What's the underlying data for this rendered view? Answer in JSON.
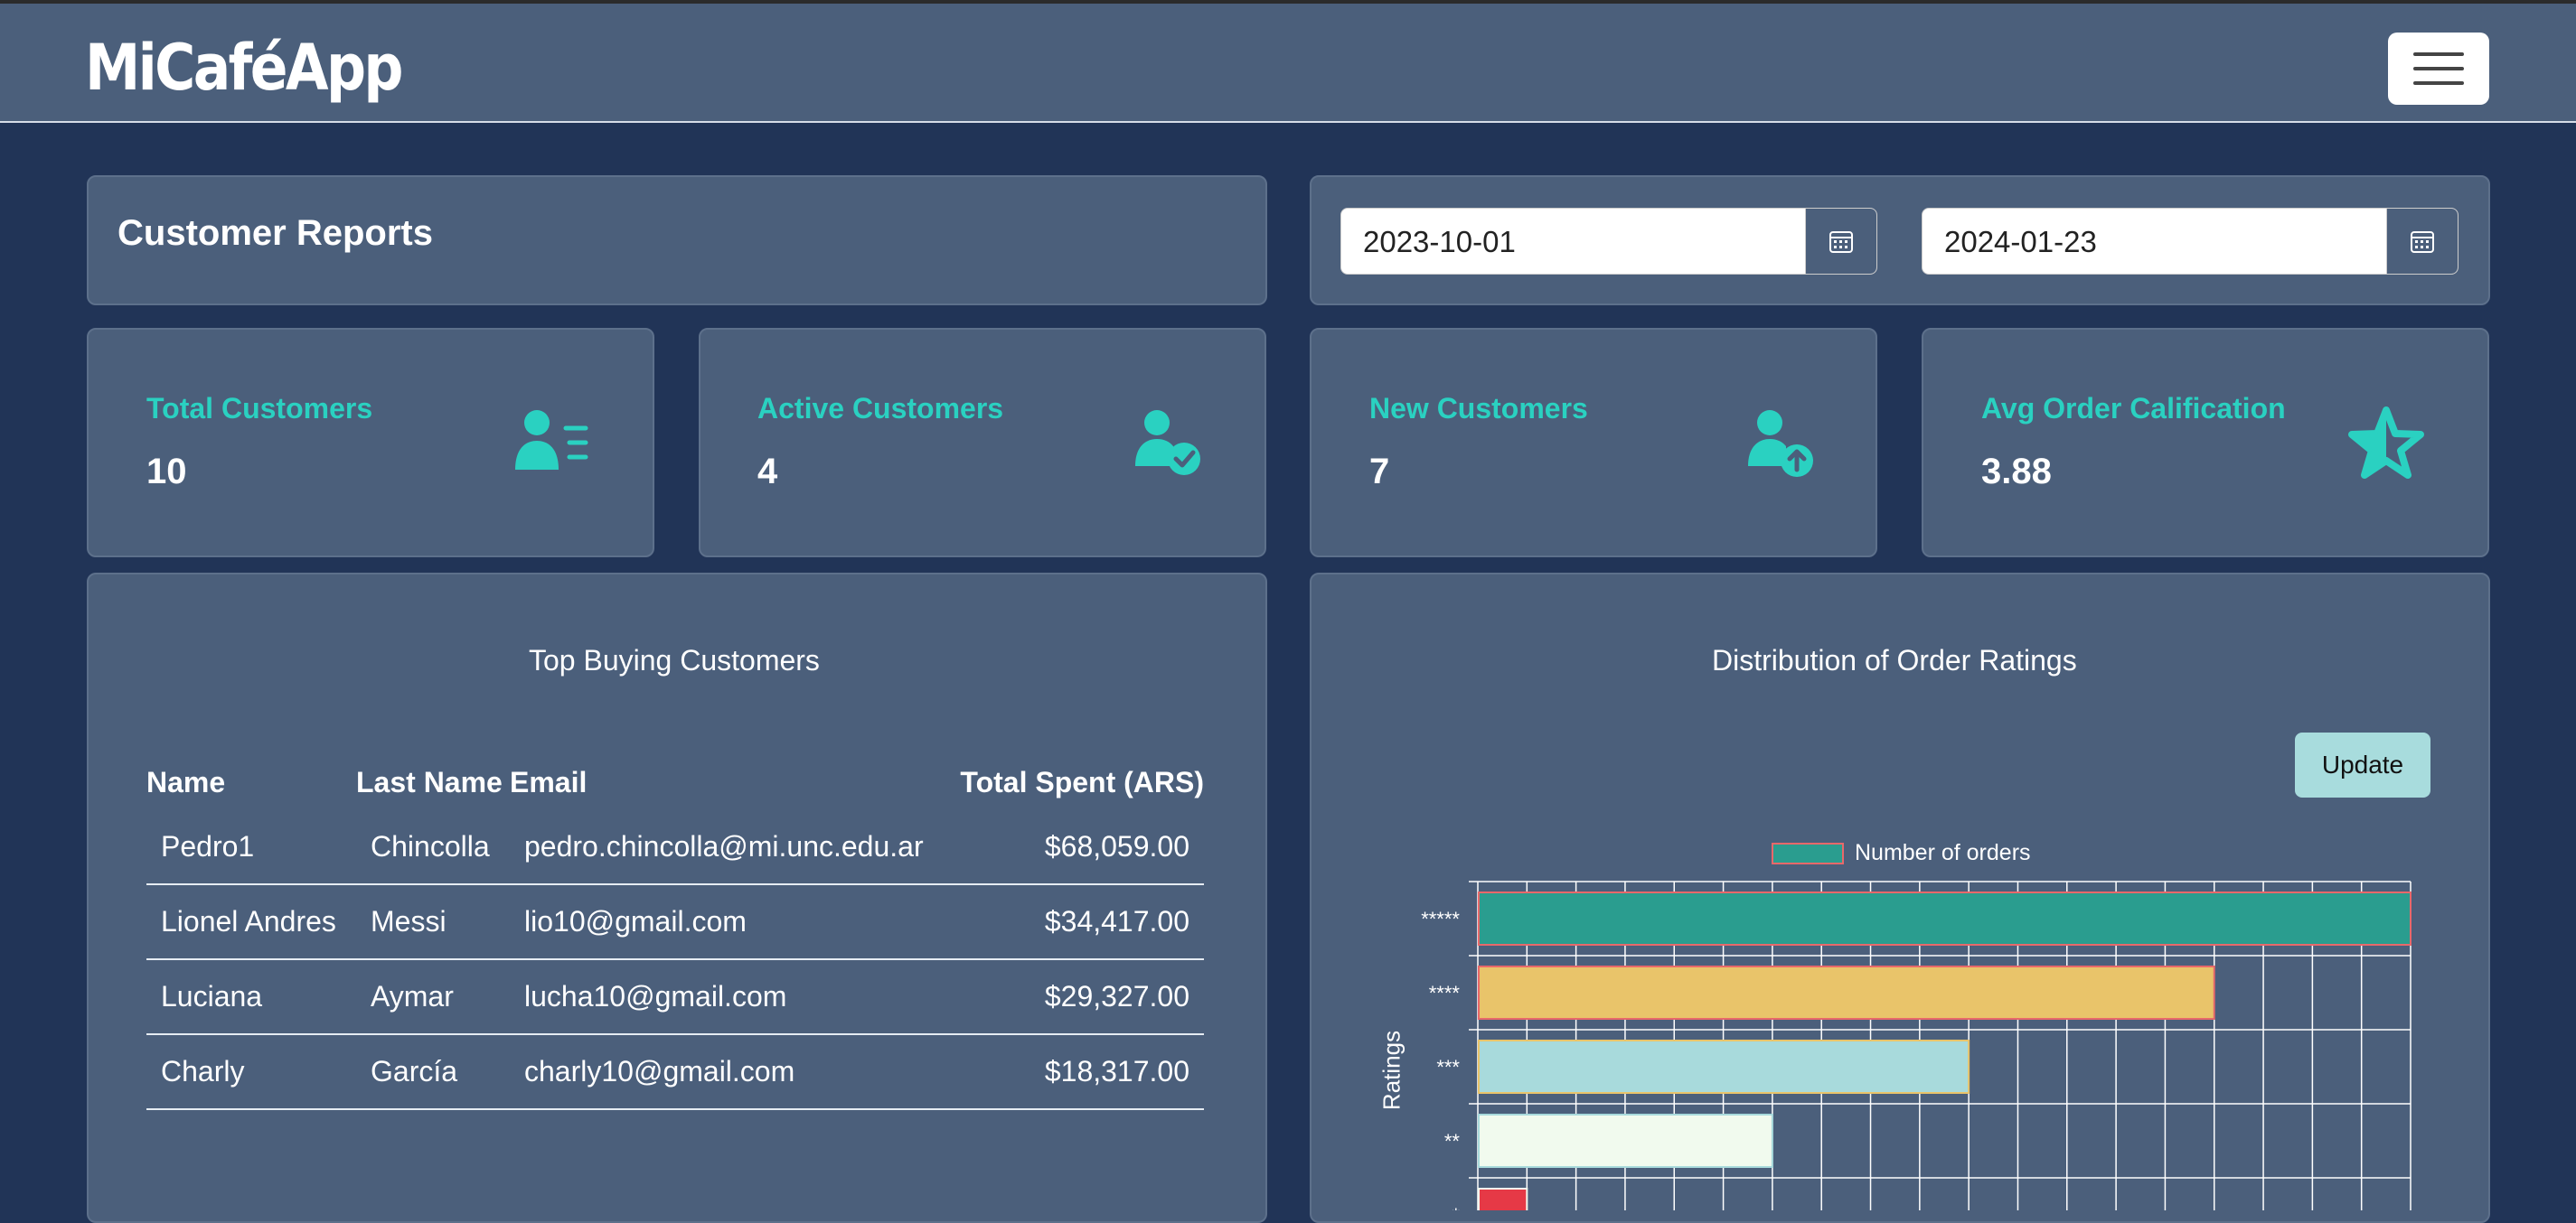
{
  "app": {
    "brand": "MiCaféApp"
  },
  "page": {
    "title": "Customer Reports"
  },
  "dates": {
    "start": "2023-10-01",
    "end": "2024-01-23"
  },
  "stats": [
    {
      "label": "Total Customers",
      "value": "10",
      "icon": "user-list-icon"
    },
    {
      "label": "Active Customers",
      "value": "4",
      "icon": "user-check-icon"
    },
    {
      "label": "New Customers",
      "value": "7",
      "icon": "user-plus-icon"
    },
    {
      "label": "Avg Order Calification",
      "value": "3.88",
      "icon": "star-icon"
    }
  ],
  "top_customers": {
    "title": "Top Buying Customers",
    "headers": [
      "Name",
      "Last Name",
      "Email",
      "Total Spent (ARS)"
    ],
    "rows": [
      [
        "Pedro1",
        "Chincolla",
        "pedro.chincolla@mi.unc.edu.ar",
        "$68,059.00"
      ],
      [
        "Lionel Andres",
        "Messi",
        "lio10@gmail.com",
        "$34,417.00"
      ],
      [
        "Luciana",
        "Aymar",
        "lucha10@gmail.com",
        "$29,327.00"
      ],
      [
        "Charly",
        "García",
        "charly10@gmail.com",
        "$18,317.00"
      ]
    ]
  },
  "ratings": {
    "title": "Distribution of Order Ratings",
    "update_label": "Update",
    "legend": "Number of orders",
    "ylabel": "Ratings",
    "colors": [
      "#2a9d8f",
      "#e9c46a",
      "#a8dadc",
      "#f1faee",
      "#e63946"
    ]
  },
  "chart_data": {
    "type": "bar",
    "orientation": "horizontal",
    "title": "Distribution of Order Ratings",
    "ylabel": "Ratings",
    "categories": [
      "*****",
      "****",
      "***",
      "**",
      "*"
    ],
    "series": [
      {
        "name": "Number of orders",
        "values": [
          19,
          15,
          10,
          6,
          1
        ]
      }
    ],
    "xlim": [
      0,
      19
    ],
    "grid": true,
    "legend": "top"
  }
}
